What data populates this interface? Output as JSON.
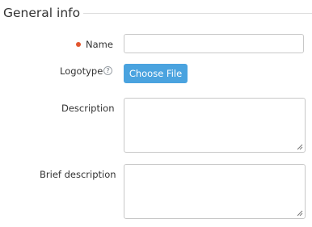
{
  "section": {
    "title": "General info"
  },
  "fields": {
    "name": {
      "label": "Name",
      "value": "",
      "required": true
    },
    "logotype": {
      "label": "Logotype",
      "help_icon": "question-circle-icon",
      "button_label": "Choose File"
    },
    "description": {
      "label": "Description",
      "value": ""
    },
    "brief_description": {
      "label": "Brief description",
      "value": ""
    }
  },
  "colors": {
    "required_marker": "#e2562f",
    "button_background": "#4aa3df",
    "border": "#c8c8c8"
  }
}
